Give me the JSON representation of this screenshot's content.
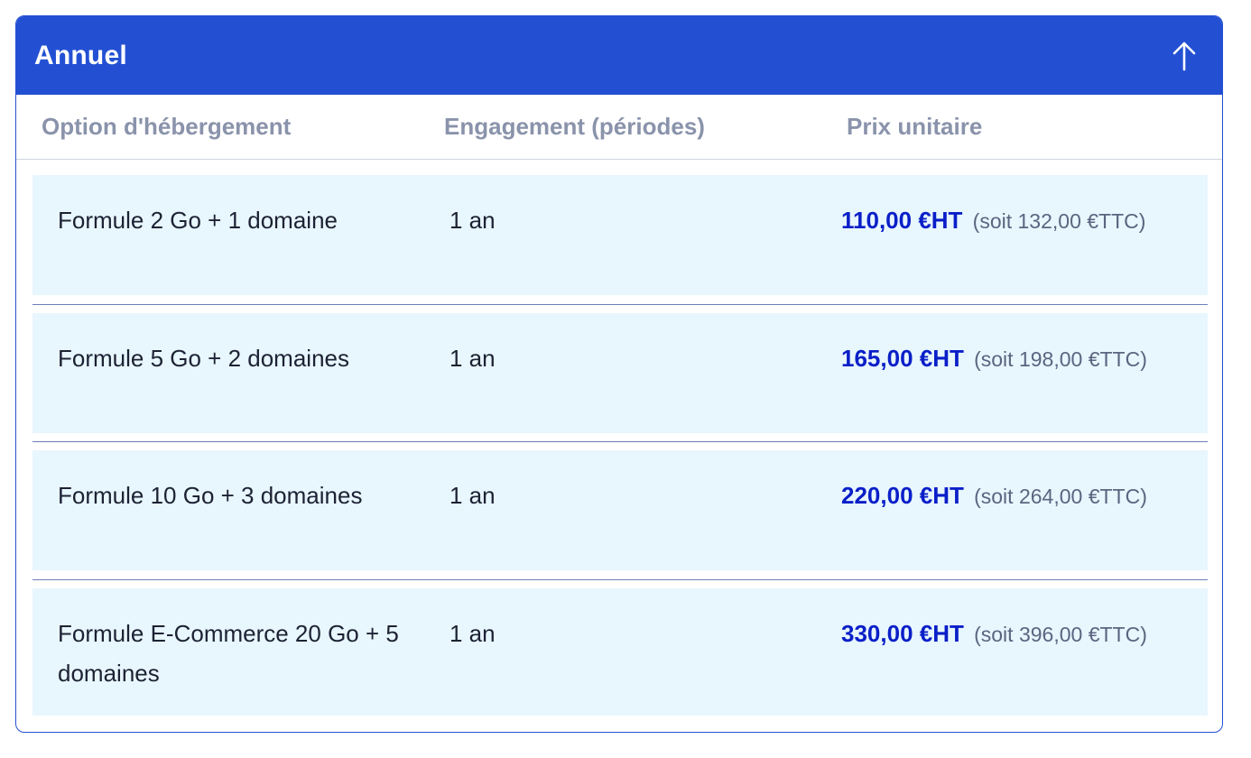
{
  "panel": {
    "title": "Annuel",
    "collapse_icon": "arrow-up-icon"
  },
  "columns": {
    "option": "Option d'hébergement",
    "engagement": "Engagement (périodes)",
    "price": "Prix unitaire"
  },
  "rows": [
    {
      "name": "Formule 2 Go + 1 domaine",
      "engagement": "1 an",
      "price_ht": "110,00 €HT",
      "price_ttc": "(soit 132,00 €TTC)"
    },
    {
      "name": "Formule 5 Go + 2 domaines",
      "engagement": "1 an",
      "price_ht": "165,00 €HT",
      "price_ttc": "(soit 198,00 €TTC)"
    },
    {
      "name": "Formule 10 Go + 3 domaines",
      "engagement": "1 an",
      "price_ht": "220,00 €HT",
      "price_ttc": "(soit 264,00 €TTC)"
    },
    {
      "name": "Formule E-Commerce 20 Go + 5 domaines",
      "engagement": "1 an",
      "price_ht": "330,00 €HT",
      "price_ttc": "(soit 396,00 €TTC)"
    }
  ],
  "colors": {
    "header_bg": "#2350d3",
    "row_bg": "#e8f6fe",
    "price_accent": "#0a1fc8",
    "column_header_text": "#8a93ab"
  }
}
